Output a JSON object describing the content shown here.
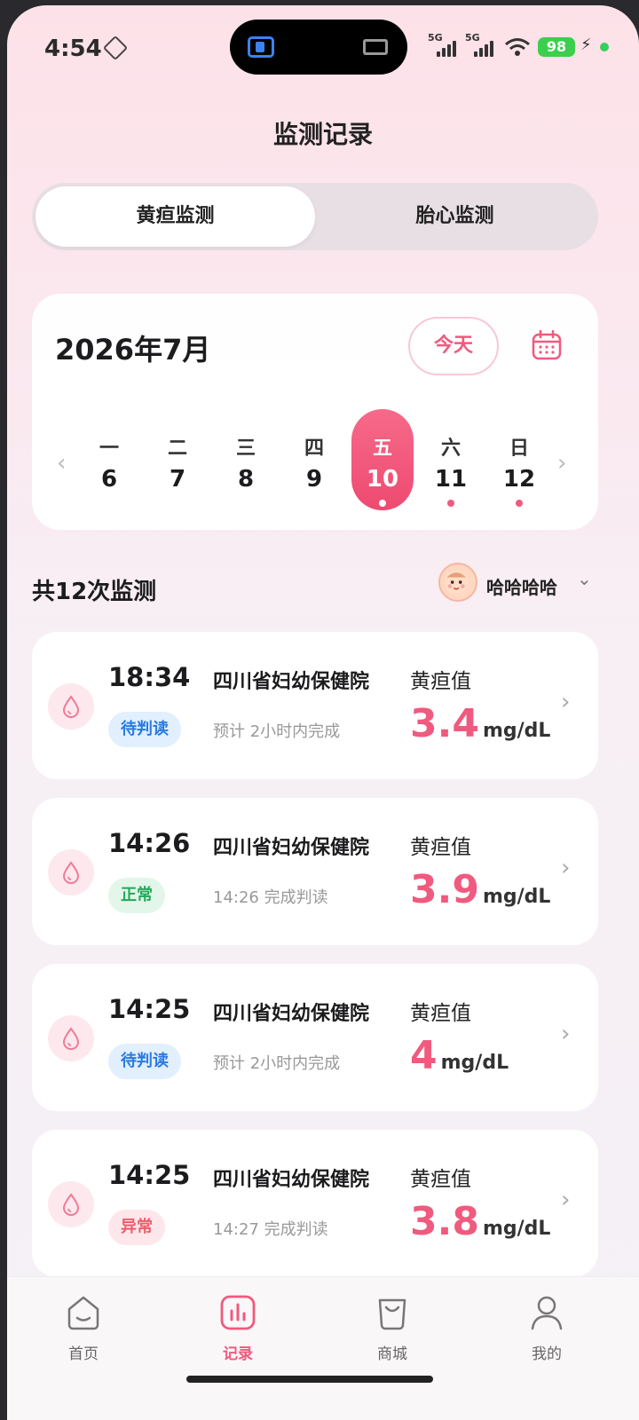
{
  "status_bar": {
    "time": "4:54",
    "signal1": "5G",
    "signal2": "5G",
    "battery": "98"
  },
  "header": {
    "title": "监测记录"
  },
  "tabs": [
    {
      "label": "黄疸监测",
      "active": true
    },
    {
      "label": "胎心监测",
      "active": false
    }
  ],
  "calendar": {
    "month": "2026年7月",
    "today_label": "今天",
    "days": [
      {
        "weekday": "一",
        "date": "6",
        "selected": false,
        "marked": false
      },
      {
        "weekday": "二",
        "date": "7",
        "selected": false,
        "marked": false
      },
      {
        "weekday": "三",
        "date": "8",
        "selected": false,
        "marked": false
      },
      {
        "weekday": "四",
        "date": "9",
        "selected": false,
        "marked": false
      },
      {
        "weekday": "五",
        "date": "10",
        "selected": true,
        "marked": true
      },
      {
        "weekday": "六",
        "date": "11",
        "selected": false,
        "marked": true
      },
      {
        "weekday": "日",
        "date": "12",
        "selected": false,
        "marked": true
      }
    ]
  },
  "summary": {
    "count_text": "共12次监测",
    "baby_name": "哈哈哈哈"
  },
  "records": [
    {
      "time": "18:34",
      "status": "待判读",
      "status_type": "pending",
      "hospital": "四川省妇幼保健院",
      "note": "预计 2小时内完成",
      "label": "黄疸值",
      "value": "3.4",
      "unit": "mg/dL"
    },
    {
      "time": "14:26",
      "status": "正常",
      "status_type": "normal",
      "hospital": "四川省妇幼保健院",
      "note": "14:26 完成判读",
      "label": "黄疸值",
      "value": "3.9",
      "unit": "mg/dL"
    },
    {
      "time": "14:25",
      "status": "待判读",
      "status_type": "pending",
      "hospital": "四川省妇幼保健院",
      "note": "预计 2小时内完成",
      "label": "黄疸值",
      "value": "4",
      "unit": "mg/dL"
    },
    {
      "time": "14:25",
      "status": "异常",
      "status_type": "abnormal",
      "hospital": "四川省妇幼保健院",
      "note": "14:27 完成判读",
      "label": "黄疸值",
      "value": "3.8",
      "unit": "mg/dL"
    }
  ],
  "nav": [
    {
      "label": "首页",
      "icon": "home-icon",
      "active": false
    },
    {
      "label": "记录",
      "icon": "chart-icon",
      "active": true
    },
    {
      "label": "商城",
      "icon": "shop-icon",
      "active": false
    },
    {
      "label": "我的",
      "icon": "user-icon",
      "active": false
    }
  ],
  "colors": {
    "accent": "#f05a7e",
    "pending": "#2a7be0",
    "normal": "#26a85a",
    "abnormal": "#f05a6a"
  }
}
